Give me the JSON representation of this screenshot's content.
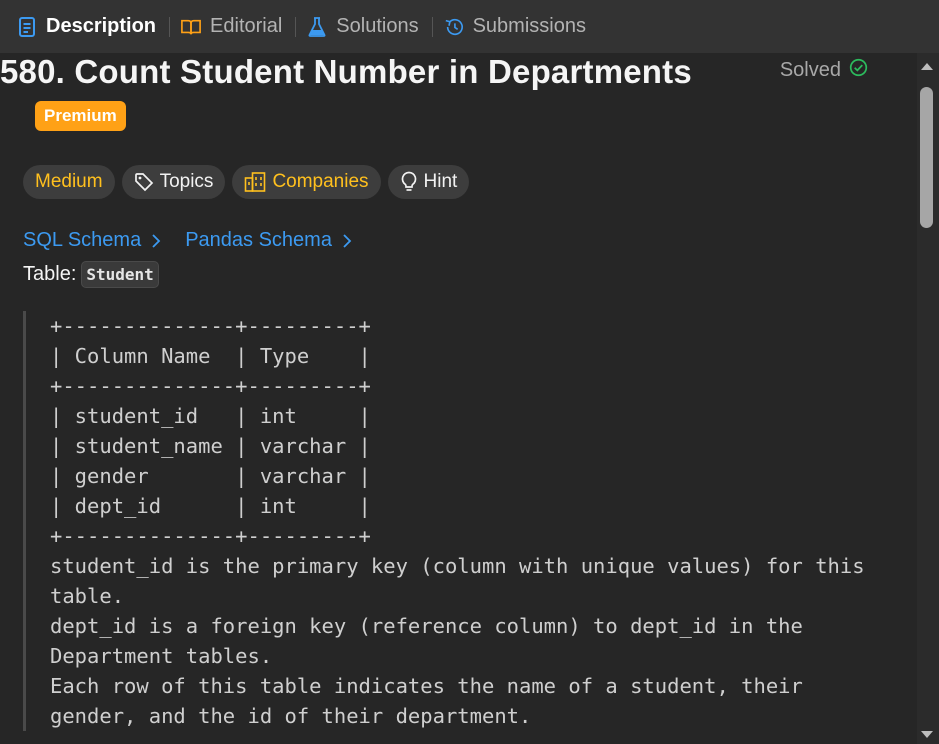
{
  "tabs": [
    {
      "label": "Description",
      "icon": "document-icon",
      "active": true
    },
    {
      "label": "Editorial",
      "icon": "book-icon",
      "active": false
    },
    {
      "label": "Solutions",
      "icon": "flask-icon",
      "active": false
    },
    {
      "label": "Submissions",
      "icon": "history-icon",
      "active": false
    }
  ],
  "problem": {
    "title": "580. Count Student Number in Departments",
    "status": "Solved",
    "badge": "Premium",
    "pills": [
      {
        "label": "Medium"
      },
      {
        "label": "Topics"
      },
      {
        "label": "Companies"
      },
      {
        "label": "Hint"
      }
    ],
    "schema_links": [
      "SQL Schema",
      "Pandas Schema"
    ],
    "table_prefix": "Table:",
    "table_name": "Student",
    "schema_lines": [
      "+--------------+---------+",
      "| Column Name  | Type    |",
      "+--------------+---------+",
      "| student_id   | int     |",
      "| student_name | varchar |",
      "| gender       | varchar |",
      "| dept_id      | int     |",
      "+--------------+---------+",
      "student_id is the primary key (column with unique values) for this",
      "table.",
      "dept_id is a foreign key (reference column) to dept_id in the",
      "Department tables.",
      "Each row of this table indicates the name of a student, their",
      "gender, and the id of their department."
    ]
  },
  "colors": {
    "accent_blue": "#3c9af1",
    "premium_orange": "#ffa116",
    "medium_yellow": "#ffc01e",
    "solved_green": "#2cbb5d"
  }
}
